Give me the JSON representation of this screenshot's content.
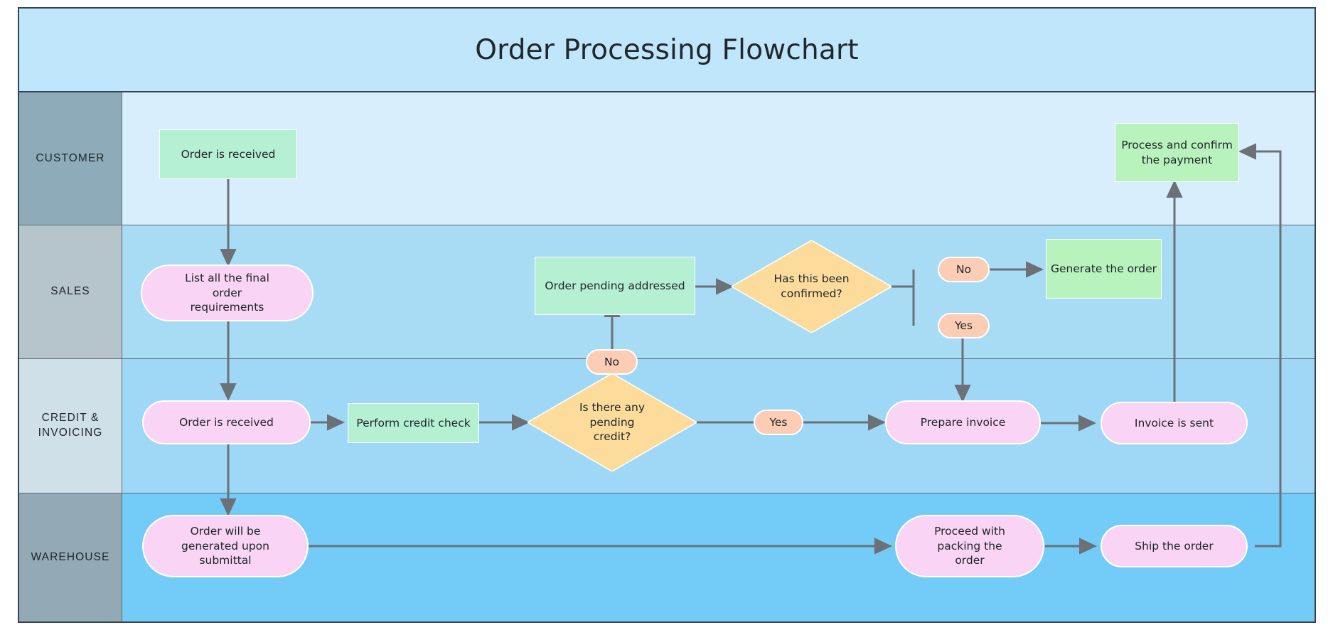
{
  "title": "Order Processing Flowchart",
  "colors": {
    "pool_border": "#35444e",
    "title_band_bg": "#bfe6fb",
    "lane_divider": "#5c6b75",
    "connector": "#6b7176",
    "process_green": "#b5f0d3",
    "node_green": "#b8f3bd",
    "node_pink": "#f9d4f4",
    "decision_yellow": "#fddc9b",
    "label_peach": "#fbcdb4",
    "text": "#20252a"
  },
  "lanes": [
    {
      "id": "customer",
      "label": "CUSTOMER",
      "header_bg": "#8eabb9",
      "body_bg": "#d8eefc"
    },
    {
      "id": "sales",
      "label": "SALES",
      "header_bg": "#b6c4cb",
      "body_bg": "#a8dcf5"
    },
    {
      "id": "credit",
      "label": "CREDIT &\nINVOICING",
      "header_bg": "#cfe0e8",
      "body_bg": "#9ed8f6"
    },
    {
      "id": "warehouse",
      "label": "WAREHOUSE",
      "header_bg": "#93aab6",
      "body_bg": "#73cbf7"
    }
  ],
  "nodes": [
    {
      "id": "order-received-customer",
      "label": "Order is received",
      "shape": "rect",
      "lane": "customer",
      "fill": "#b5f0d3"
    },
    {
      "id": "process-confirm-payment",
      "label": "Process and confirm the payment",
      "shape": "rect",
      "lane": "customer",
      "fill": "#b8f3bd"
    },
    {
      "id": "list-order-requirements",
      "label": "List all the final order requirements",
      "shape": "rounded",
      "lane": "sales",
      "fill": "#f9d4f4"
    },
    {
      "id": "order-pending-addressed",
      "label": "Order pending addressed",
      "shape": "rect",
      "lane": "sales",
      "fill": "#b5f0d3"
    },
    {
      "id": "has-this-been-confirmed",
      "label": "Has this been confirmed?",
      "shape": "diamond",
      "lane": "sales",
      "fill": "#fddc9b"
    },
    {
      "id": "generate-the-order",
      "label": "Generate the order",
      "shape": "rect",
      "lane": "sales",
      "fill": "#b8f3bd"
    },
    {
      "id": "order-received-credit",
      "label": "Order is received",
      "shape": "rounded",
      "lane": "credit",
      "fill": "#f9d4f4"
    },
    {
      "id": "perform-credit-check",
      "label": "Perform credit check",
      "shape": "rect",
      "lane": "credit",
      "fill": "#b5f0d3"
    },
    {
      "id": "is-there-pending-credit",
      "label": "Is there any pending credit?",
      "shape": "diamond",
      "lane": "credit",
      "fill": "#fddc9b"
    },
    {
      "id": "prepare-invoice",
      "label": "Prepare invoice",
      "shape": "rounded",
      "lane": "credit",
      "fill": "#f9d4f4"
    },
    {
      "id": "invoice-is-sent",
      "label": "Invoice is sent",
      "shape": "rounded",
      "lane": "credit",
      "fill": "#f9d4f4"
    },
    {
      "id": "order-generated-upon-submittal",
      "label": "Order will be generated upon submittal",
      "shape": "rounded",
      "lane": "warehouse",
      "fill": "#f9d4f4"
    },
    {
      "id": "proceed-with-packing",
      "label": "Proceed with packing the order",
      "shape": "rounded",
      "lane": "warehouse",
      "fill": "#f9d4f4"
    },
    {
      "id": "ship-the-order",
      "label": "Ship the order",
      "shape": "rounded",
      "lane": "warehouse",
      "fill": "#f9d4f4"
    }
  ],
  "edge_labels": [
    {
      "id": "no-pending-credit",
      "label": "No",
      "fill": "#fbcdb4"
    },
    {
      "id": "yes-pending-credit",
      "label": "Yes",
      "fill": "#fbcdb4"
    },
    {
      "id": "no-confirmed",
      "label": "No",
      "fill": "#fbcdb4"
    },
    {
      "id": "yes-confirmed",
      "label": "Yes",
      "fill": "#fbcdb4"
    }
  ],
  "node_text": {
    "order_received_customer": "Order is received",
    "process_confirm_payment_l1": "Process and confirm",
    "process_confirm_payment_l2": "the payment",
    "list_requirements_l1": "List all the final",
    "list_requirements_l2": "order",
    "list_requirements_l3": "requirements",
    "order_pending_addressed": "Order pending addressed",
    "has_confirmed_l1": "Has this been",
    "has_confirmed_l2": "confirmed?",
    "generate_the_order": "Generate the order",
    "order_received_credit": "Order is received",
    "perform_credit_check": "Perform credit check",
    "pending_credit_l1": "Is there any",
    "pending_credit_l2": "pending",
    "pending_credit_l3": "credit?",
    "prepare_invoice": "Prepare invoice",
    "invoice_is_sent": "Invoice is sent",
    "order_generated_l1": "Order will be",
    "order_generated_l2": "generated upon",
    "order_generated_l3": "submittal",
    "proceed_packing_l1": "Proceed with",
    "proceed_packing_l2": "packing the",
    "proceed_packing_l3": "order",
    "ship_the_order": "Ship the order",
    "label_no_1": "No",
    "label_no_2": "No",
    "label_yes_1": "Yes",
    "label_yes_2": "Yes"
  },
  "lane_text": {
    "customer": "CUSTOMER",
    "sales": "SALES",
    "credit_l1": "CREDIT &",
    "credit_l2": "INVOICING",
    "warehouse": "WAREHOUSE"
  }
}
